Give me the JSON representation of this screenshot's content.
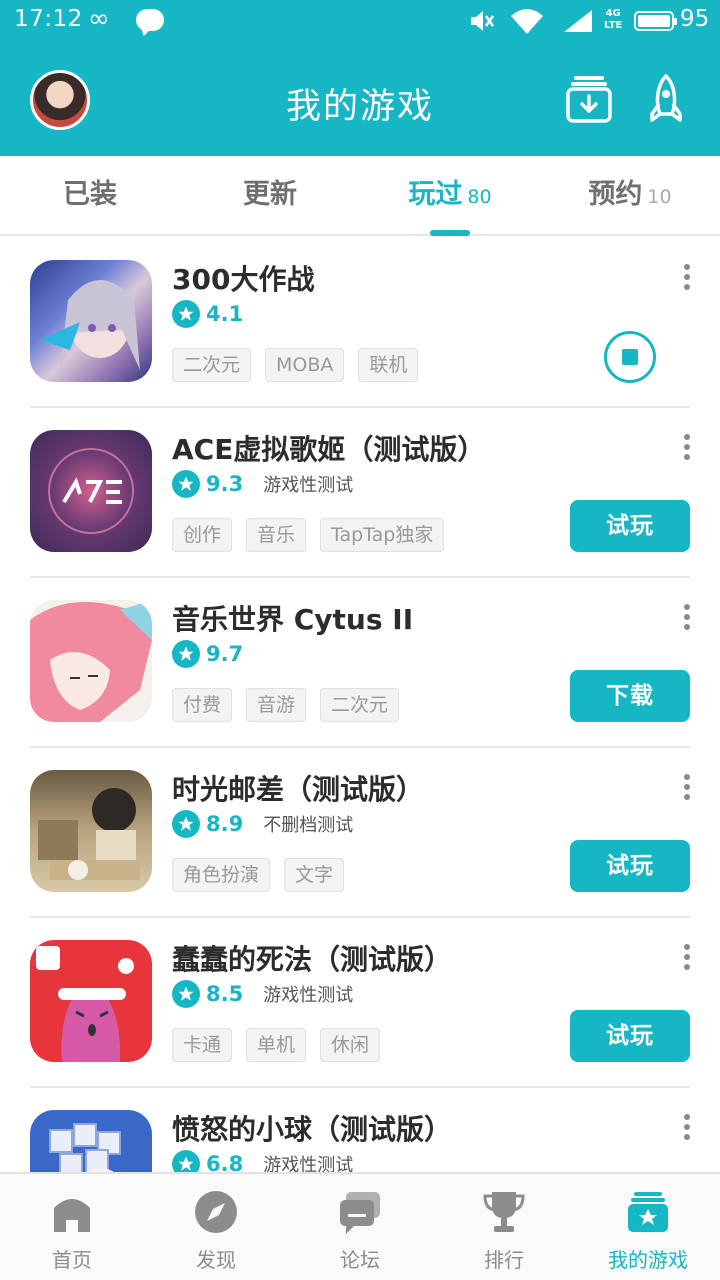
{
  "status_bar": {
    "time": "17:12",
    "battery": "95",
    "network": "4G"
  },
  "header": {
    "title": "我的游戏"
  },
  "tabs": [
    {
      "label": "已装",
      "count": ""
    },
    {
      "label": "更新",
      "count": ""
    },
    {
      "label": "玩过",
      "count": "80"
    },
    {
      "label": "预约",
      "count": "10"
    }
  ],
  "active_tab": "玩过",
  "games": [
    {
      "name": "300大作战",
      "score": "4.1",
      "note": "",
      "tags": [
        "二次元",
        "MOBA",
        "联机"
      ],
      "action": "downloading",
      "action_label": ""
    },
    {
      "name": "ACE虚拟歌姬（测试版）",
      "score": "9.3",
      "note": "游戏性测试",
      "tags": [
        "创作",
        "音乐",
        "TapTap独家"
      ],
      "action": "button",
      "action_label": "试玩"
    },
    {
      "name": "音乐世界 Cytus II",
      "score": "9.7",
      "note": "",
      "tags": [
        "付费",
        "音游",
        "二次元"
      ],
      "action": "button",
      "action_label": "下载"
    },
    {
      "name": "时光邮差（测试版）",
      "score": "8.9",
      "note": "不删档测试",
      "tags": [
        "角色扮演",
        "文字"
      ],
      "action": "button",
      "action_label": "试玩"
    },
    {
      "name": "蠢蠢的死法（测试版）",
      "score": "8.5",
      "note": "游戏性测试",
      "tags": [
        "卡通",
        "单机",
        "休闲"
      ],
      "action": "button",
      "action_label": "试玩"
    },
    {
      "name": "愤怒的小球（测试版）",
      "score": "6.8",
      "note": "游戏性测试",
      "tags": [],
      "action": "none",
      "action_label": ""
    }
  ],
  "bottom_nav": [
    {
      "label": "首页",
      "icon": "home-icon"
    },
    {
      "label": "发现",
      "icon": "compass-icon"
    },
    {
      "label": "论坛",
      "icon": "forum-icon"
    },
    {
      "label": "排行",
      "icon": "trophy-icon"
    },
    {
      "label": "我的游戏",
      "icon": "my-games-icon"
    }
  ],
  "colors": {
    "accent": "#16b6c5",
    "text": "#2c2c2c",
    "muted": "#999999"
  }
}
